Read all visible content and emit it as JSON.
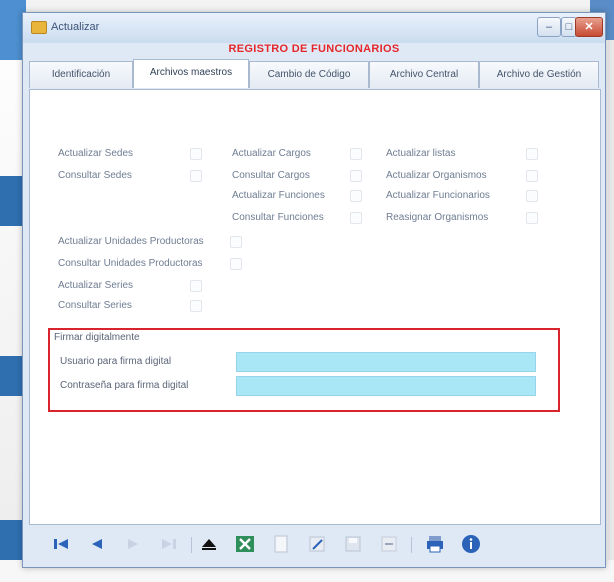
{
  "window": {
    "title": "Actualizar"
  },
  "form": {
    "title": "REGISTRO DE FUNCIONARIOS"
  },
  "tabs": [
    {
      "label": "Identificación"
    },
    {
      "label": "Archivos maestros"
    },
    {
      "label": "Cambio de Código"
    },
    {
      "label": "Archivo Central"
    },
    {
      "label": "Archivo de Gestión"
    }
  ],
  "permissions": [
    {
      "label": "Actualizar Sedes"
    },
    {
      "label": "Consultar Sedes"
    },
    {
      "label": "Actualizar Cargos"
    },
    {
      "label": "Consultar Cargos"
    },
    {
      "label": "Actualizar Funciones"
    },
    {
      "label": "Consultar Funciones"
    },
    {
      "label": "Actualizar listas"
    },
    {
      "label": "Actualizar Organismos"
    },
    {
      "label": "Actualizar Funcionarios"
    },
    {
      "label": "Reasignar Organismos"
    },
    {
      "label": "Actualizar Unidades Productoras"
    },
    {
      "label": "Consultar Unidades Productoras"
    },
    {
      "label": "Actualizar Series"
    },
    {
      "label": "Consultar Series"
    }
  ],
  "signature": {
    "heading": "Firmar digitalmente",
    "user_label": "Usuario para firma digital",
    "user_value": "",
    "password_label": "Contraseña para firma digital",
    "password_value": ""
  },
  "toolbar": {
    "buttons": [
      {
        "icon": "first-record-icon"
      },
      {
        "icon": "previous-record-icon"
      },
      {
        "icon": "next-record-icon"
      },
      {
        "icon": "last-record-icon"
      },
      {
        "icon": "eject-icon"
      },
      {
        "icon": "excel-icon"
      },
      {
        "icon": "new-document-icon"
      },
      {
        "icon": "edit-icon"
      },
      {
        "icon": "save-icon"
      },
      {
        "icon": "delete-icon"
      },
      {
        "icon": "print-icon"
      },
      {
        "icon": "help-icon"
      }
    ]
  },
  "colors": {
    "accent_red": "#e5262a",
    "highlight_border": "#d9242e",
    "input_fill": "#a9e6f6",
    "window_frame": "#dfe9f6",
    "toolbar_blue": "#2a63b8"
  }
}
